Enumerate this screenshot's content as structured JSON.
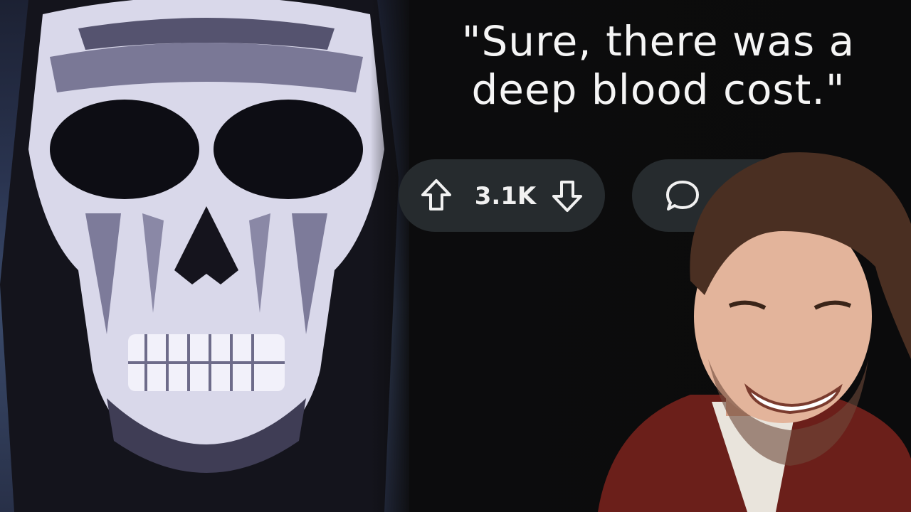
{
  "post": {
    "caption": "\"Sure, there was a\ndeep blood cost.\""
  },
  "actions": {
    "upvote_icon": "arrow-up-icon",
    "downvote_icon": "arrow-down-icon",
    "vote_count": "3.1K",
    "comment_icon": "speech-bubble-icon"
  },
  "colors": {
    "pill_bg": "#262b2e",
    "panel_bg": "#0b0b0c",
    "text": "#f5f5f5"
  }
}
